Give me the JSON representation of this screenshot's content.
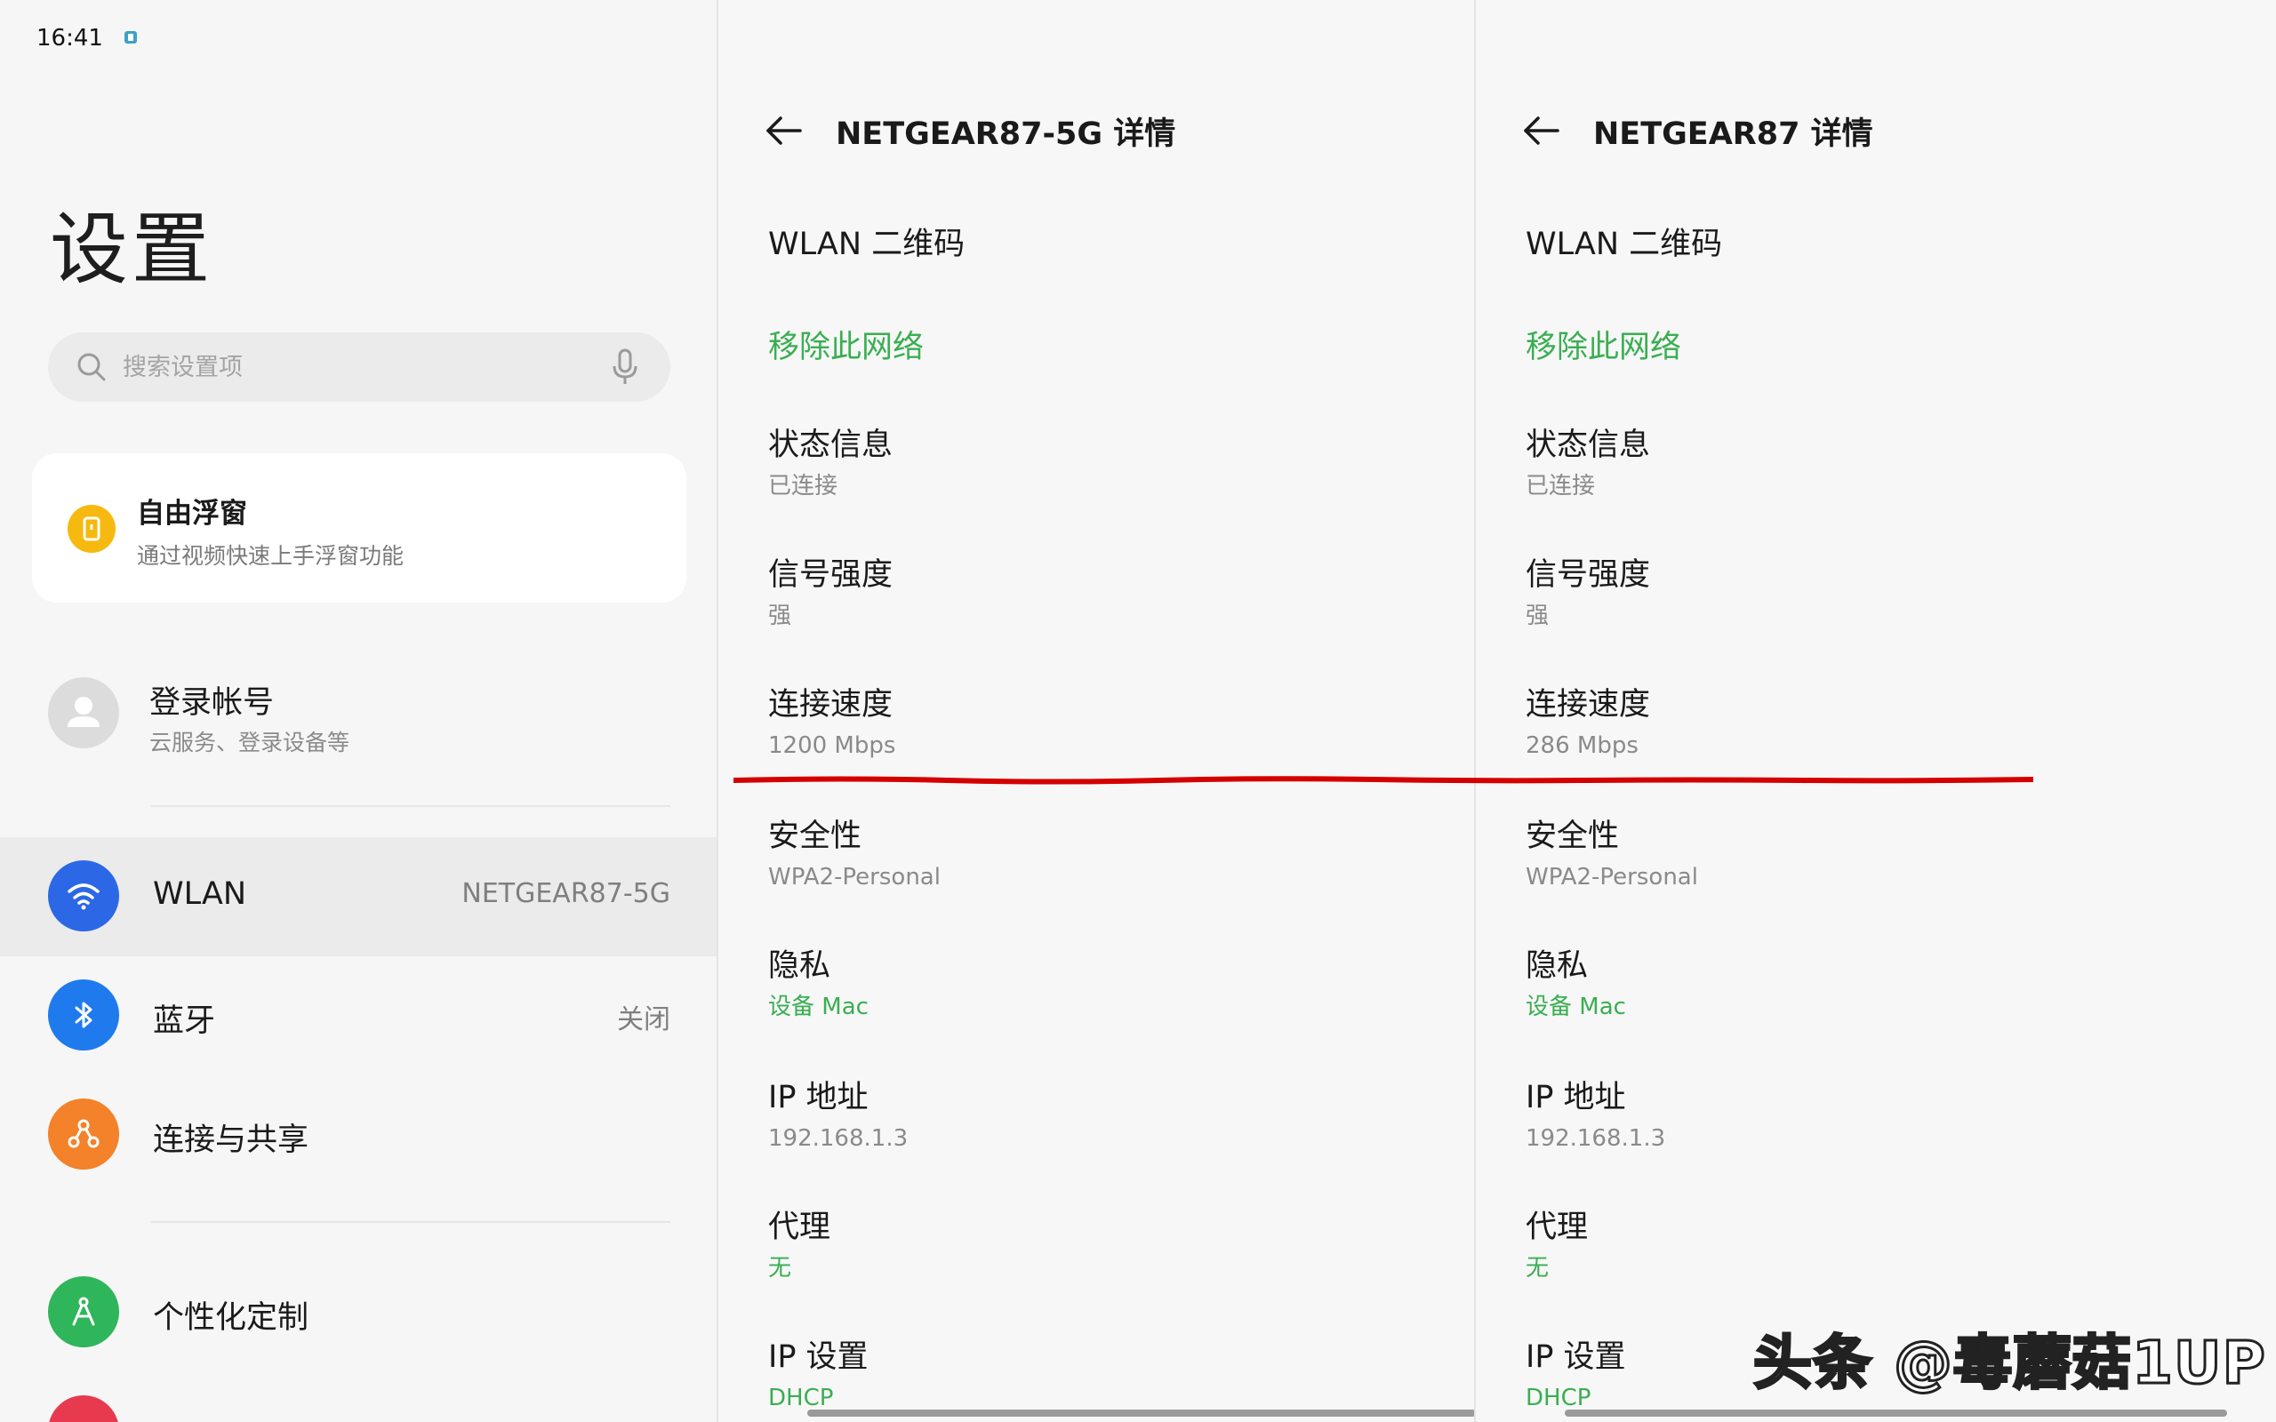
{
  "status_bar": {
    "time": "16:41"
  },
  "settings": {
    "title": "设置",
    "search": {
      "placeholder": "搜索设置项"
    },
    "promo": {
      "title": "自由浮窗",
      "subtitle": "通过视频快速上手浮窗功能"
    },
    "account": {
      "title": "登录帐号",
      "subtitle": "云服务、登录设备等"
    },
    "items": [
      {
        "label": "WLAN",
        "value": "NETGEAR87-5G",
        "icon": "wifi-icon",
        "color": "#2c68e6",
        "selected": true
      },
      {
        "label": "蓝牙",
        "value": "关闭",
        "icon": "bluetooth-icon",
        "color": "#1f7aee"
      },
      {
        "label": "连接与共享",
        "value": "",
        "icon": "share-icon",
        "color": "#f3822a"
      },
      {
        "label": "个性化定制",
        "value": "",
        "icon": "personalize-icon",
        "color": "#2fb55a"
      }
    ]
  },
  "detail_5g": {
    "title": "NETGEAR87-5G 详情",
    "qr": "WLAN 二维码",
    "remove": "移除此网络",
    "status": {
      "label": "状态信息",
      "value": "已连接"
    },
    "signal": {
      "label": "信号强度",
      "value": "强"
    },
    "speed": {
      "label": "连接速度",
      "value": "1200 Mbps"
    },
    "security": {
      "label": "安全性",
      "value": "WPA2-Personal"
    },
    "privacy": {
      "label": "隐私",
      "value": "设备 Mac"
    },
    "ip": {
      "label": "IP 地址",
      "value": "192.168.1.3"
    },
    "proxy": {
      "label": "代理",
      "value": "无"
    },
    "ip_settings": {
      "label": "IP 设置",
      "value": "DHCP"
    }
  },
  "detail_24g": {
    "title": "NETGEAR87 详情",
    "qr": "WLAN 二维码",
    "remove": "移除此网络",
    "status": {
      "label": "状态信息",
      "value": "已连接"
    },
    "signal": {
      "label": "信号强度",
      "value": "强"
    },
    "speed": {
      "label": "连接速度",
      "value": "286 Mbps"
    },
    "security": {
      "label": "安全性",
      "value": "WPA2-Personal"
    },
    "privacy": {
      "label": "隐私",
      "value": "设备 Mac"
    },
    "ip": {
      "label": "IP 地址",
      "value": "192.168.1.3"
    },
    "proxy": {
      "label": "代理",
      "value": "无"
    },
    "ip_settings": {
      "label": "IP 设置",
      "value": "DHCP"
    }
  },
  "watermark": "头条 @毒蘑菇1UP",
  "colors": {
    "accent_green": "#3aae52",
    "annotation_red": "#d40000",
    "promo_yellow": "#f6b90f"
  }
}
